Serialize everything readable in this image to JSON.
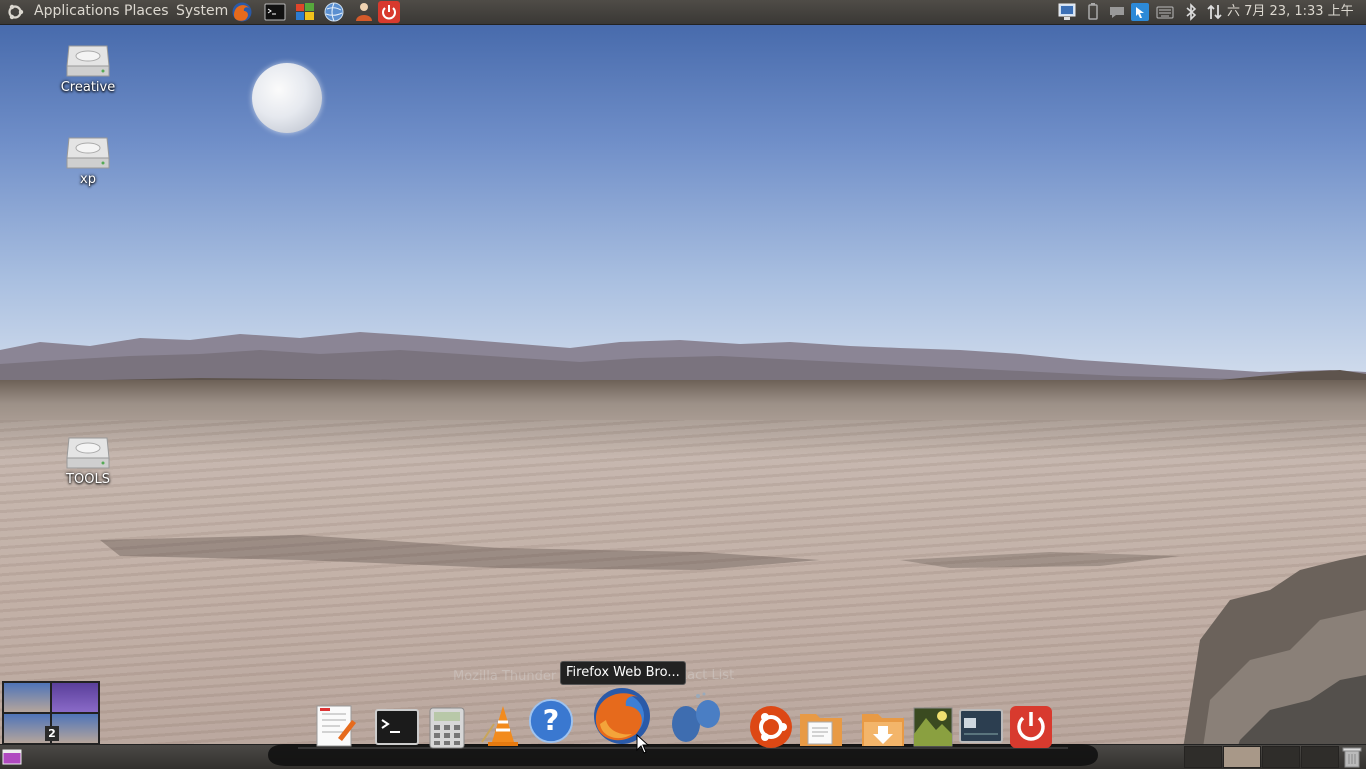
{
  "top_panel": {
    "menus": [
      "Applications",
      "Places",
      "System"
    ],
    "launchers": [
      "firefox-icon",
      "terminal-icon",
      "windows-flag-icon",
      "network-globe-icon",
      "user-switch-icon",
      "power-icon"
    ],
    "tray": [
      "monitor-icon",
      "battery-icon",
      "chat-icon",
      "chrome-app-icon",
      "keyboard-icon",
      "bluetooth-icon",
      "network-updown-icon"
    ],
    "clock": "六 7月 23,  1:33 上午"
  },
  "desktop_icons": [
    {
      "label": "Creative",
      "icon": "hard-drive-icon"
    },
    {
      "label": "xp",
      "icon": "hard-drive-icon"
    },
    {
      "label": "TOOLS",
      "icon": "hard-drive-icon"
    }
  ],
  "workspace_switcher": {
    "active_count": "2"
  },
  "dock": {
    "items": [
      "text-editor-icon",
      "terminal-icon",
      "calculator-icon",
      "vlc-icon",
      "help-icon",
      "firefox-icon",
      "pidgin-icon",
      "ubuntu-software-icon",
      "documents-folder-icon",
      "downloads-folder-icon",
      "image-viewer-icon",
      "system-monitor-icon",
      "shutdown-icon"
    ],
    "ghost_label_left": "Mozilla Thunder",
    "ghost_label_right": "tact List",
    "tooltip": "Firefox Web Bro..."
  },
  "colors": {
    "panel": "#3a3835",
    "panel_text": "#dfdbd2",
    "accent_orange": "#e66a1c",
    "power_red": "#d83a2e"
  }
}
